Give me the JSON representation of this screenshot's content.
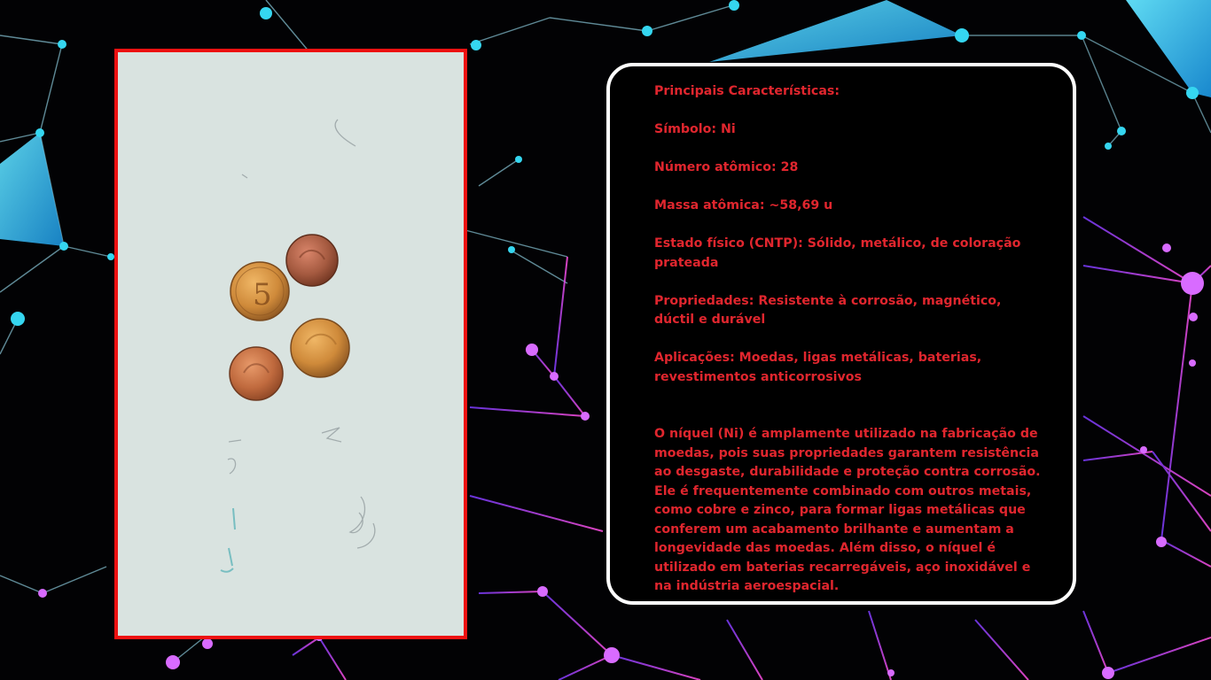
{
  "colors": {
    "frame_border": "#ee1111",
    "card_border": "#ffffff",
    "card_background": "#000000",
    "text": "#e0262e",
    "background": "#020204",
    "network_cyan": "#35d6f0",
    "network_magenta": "#d050ff"
  },
  "photo": {
    "icon": "coins-photo",
    "coin_count": 4
  },
  "info": {
    "heading": "Principais Características:",
    "symbol": "Símbolo: Ni",
    "atomic_number": "Número atômico: 28",
    "atomic_mass": "Massa atômica: ~58,69 u",
    "physical_state": "Estado físico (CNTP): Sólido, metálico, de coloração prateada",
    "properties": "Propriedades: Resistente à corrosão, magnético, dúctil e durável",
    "applications": "Aplicações: Moedas, ligas metálicas, baterias, revestimentos anticorrosivos",
    "description": "O níquel (Ni) é amplamente utilizado na fabricação de moedas, pois suas propriedades garantem resistência ao desgaste, durabilidade e proteção contra corrosão. Ele é frequentemente combinado com outros metais, como cobre e zinco, para formar ligas metálicas que conferem um acabamento brilhante e aumentam a longevidade das moedas. Além disso, o níquel é utilizado em baterias recarregáveis, aço inoxidável e na indústria aeroespacial."
  }
}
